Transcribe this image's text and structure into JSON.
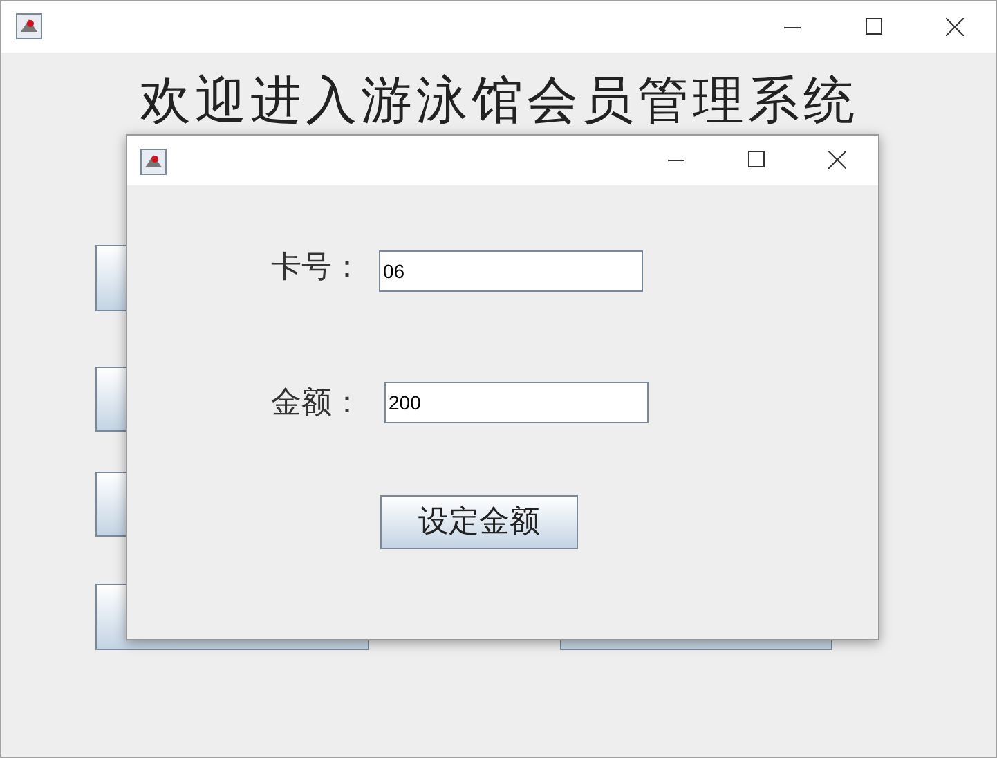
{
  "main_window": {
    "heading": "欢迎进入游泳馆会员管理系统"
  },
  "dialog": {
    "fields": [
      {
        "label": "卡号：",
        "value": "06"
      },
      {
        "label": "金额：",
        "value": "200"
      }
    ],
    "button": "设定金额"
  }
}
